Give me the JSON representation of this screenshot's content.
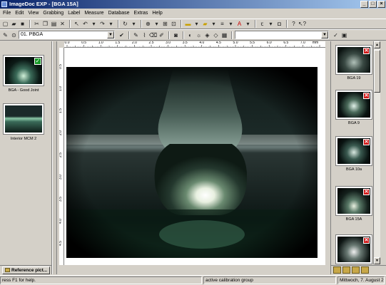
{
  "window": {
    "title": "ImageDoc EXP - [BGA 15A]",
    "buttons": [
      "_",
      "□",
      "×"
    ]
  },
  "menu": [
    "File",
    "Edit",
    "View",
    "Grabbing",
    "Label",
    "Measure",
    "Database",
    "Extras",
    "Help"
  ],
  "toolbar2": {
    "preset_value": "01. PBGA",
    "right_combo_value": ""
  },
  "ruler": {
    "unit": "mm",
    "h_labels": [
      "0.0",
      "0.5",
      "1.0",
      "1.5",
      "2.0",
      "2.5",
      "3.0",
      "3.5",
      "4.0",
      "4.5",
      "5.0",
      "5.5",
      "6.0",
      "6.5",
      "7.0"
    ],
    "v_labels": [
      "0.5",
      "1.0",
      "1.5",
      "2.0",
      "2.5",
      "3.0",
      "3.5",
      "4.0",
      "4.5"
    ]
  },
  "left_gallery": {
    "items": [
      {
        "caption": "BGA - Good Joint",
        "checked": true
      },
      {
        "caption": "Interior MCM 2",
        "checked": false
      }
    ],
    "tab_label": "Reference pict..."
  },
  "right_gallery": {
    "items": [
      {
        "caption": "BGA 19"
      },
      {
        "caption": "BGA 9"
      },
      {
        "caption": "BGA 10a"
      },
      {
        "caption": "BGA 15A"
      },
      {
        "caption": ""
      }
    ]
  },
  "status": {
    "help": "ress F1 for help.",
    "calibration": "active calibration group",
    "date": "Mittwoch, 7. August 200"
  },
  "colors": {
    "title_start": "#0a246a",
    "title_end": "#a6caf0",
    "reject_mark": "#d01818",
    "accept_mark": "#1a9a2a"
  }
}
